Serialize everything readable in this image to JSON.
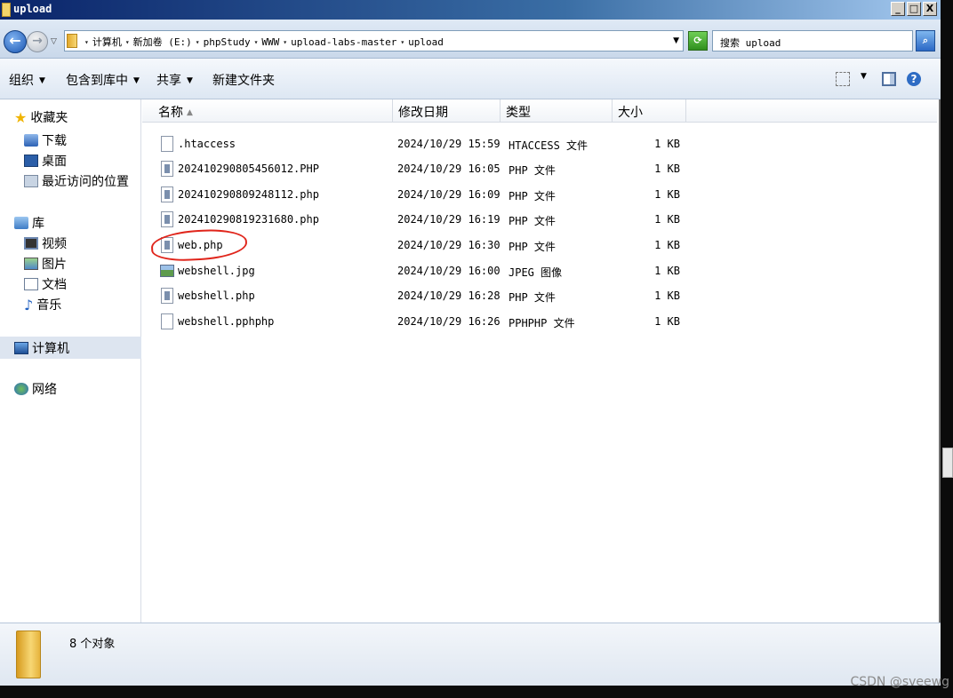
{
  "window": {
    "title": "upload",
    "min": "_",
    "max": "□",
    "close": "X"
  },
  "address": {
    "crumbs": [
      "计算机",
      "新加卷 (E:)",
      "phpStudy",
      "WWW",
      "upload-labs-master",
      "upload"
    ],
    "search_label": "搜索 upload"
  },
  "toolbar": {
    "organize": "组织",
    "include_library": "包含到库中",
    "share": "共享",
    "new_folder": "新建文件夹"
  },
  "nav": {
    "favorites": "收藏夹",
    "downloads": "下载",
    "desktop": "桌面",
    "recent": "最近访问的位置",
    "libraries": "库",
    "videos": "视频",
    "pictures": "图片",
    "documents": "文档",
    "music": "音乐",
    "computer": "计算机",
    "network": "网络"
  },
  "columns": {
    "name": "名称",
    "date": "修改日期",
    "type": "类型",
    "size": "大小"
  },
  "files": [
    {
      "name": ".htaccess",
      "date": "2024/10/29 15:59",
      "type": "HTACCESS 文件",
      "size": "1 KB",
      "icon": "blank-file-icon"
    },
    {
      "name": "202410290805456012.PHP",
      "date": "2024/10/29 16:05",
      "type": "PHP 文件",
      "size": "1 KB",
      "icon": "php-file-icon"
    },
    {
      "name": "202410290809248112.php",
      "date": "2024/10/29 16:09",
      "type": "PHP 文件",
      "size": "1 KB",
      "icon": "php-file-icon"
    },
    {
      "name": "202410290819231680.php",
      "date": "2024/10/29 16:19",
      "type": "PHP 文件",
      "size": "1 KB",
      "icon": "php-file-icon"
    },
    {
      "name": "web.php",
      "date": "2024/10/29 16:30",
      "type": "PHP 文件",
      "size": "1 KB",
      "icon": "php-file-icon"
    },
    {
      "name": "webshell.jpg",
      "date": "2024/10/29 16:00",
      "type": "JPEG 图像",
      "size": "1 KB",
      "icon": "jpeg-file-icon"
    },
    {
      "name": "webshell.php",
      "date": "2024/10/29 16:28",
      "type": "PHP 文件",
      "size": "1 KB",
      "icon": "php-file-icon"
    },
    {
      "name": "webshell.pphphp",
      "date": "2024/10/29 16:26",
      "type": "PPHPHP 文件",
      "size": "1 KB",
      "icon": "blank-file-icon"
    }
  ],
  "status": {
    "count": "8 个对象"
  },
  "watermark": "CSDN @sveewg",
  "colors": {
    "title_bar": "#0a246a",
    "annotation": "#e0251b",
    "selection": "#dde5f0"
  }
}
